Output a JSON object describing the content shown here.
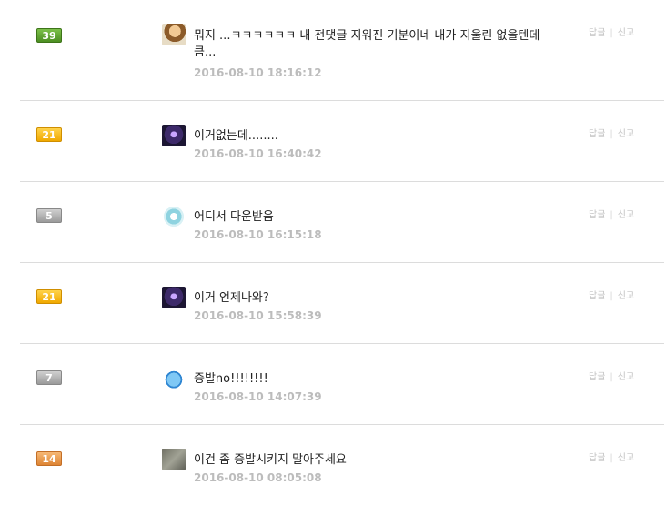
{
  "comments": [
    {
      "level": "39",
      "level_color": "#4c8e22",
      "text": "뭐지 ...ㅋㅋㅋㅋㅋㅋ 내 전댓글 지워진 기분이네 내가 지울린 없을텐데큼...",
      "time": "2016-08-10 18:16:12",
      "avatar": "avatar-kid"
    },
    {
      "level": "21",
      "level_color": "#f0a800",
      "text": "이거없는데........",
      "time": "2016-08-10 16:40:42",
      "avatar": "avatar-dark"
    },
    {
      "level": "5",
      "level_color": "#9a9a9a",
      "text": "어디서 다운받음",
      "time": "2016-08-10 16:15:18",
      "avatar": "avatar-badge"
    },
    {
      "level": "21",
      "level_color": "#f0a800",
      "text": "이거 언제나와?",
      "time": "2016-08-10 15:58:39",
      "avatar": "avatar-dark"
    },
    {
      "level": "7",
      "level_color": "#9a9a9a",
      "text": "증발no!!!!!!!!",
      "time": "2016-08-10 14:07:39",
      "avatar": "avatar-egg"
    },
    {
      "level": "14",
      "level_color": "#dd8434",
      "text": "이건 좀 증발시키지 말아주세요",
      "time": "2016-08-10 08:05:08",
      "avatar": "avatar-photo"
    }
  ],
  "actions": {
    "reply": "답글",
    "report": "신고",
    "separator": "|"
  }
}
